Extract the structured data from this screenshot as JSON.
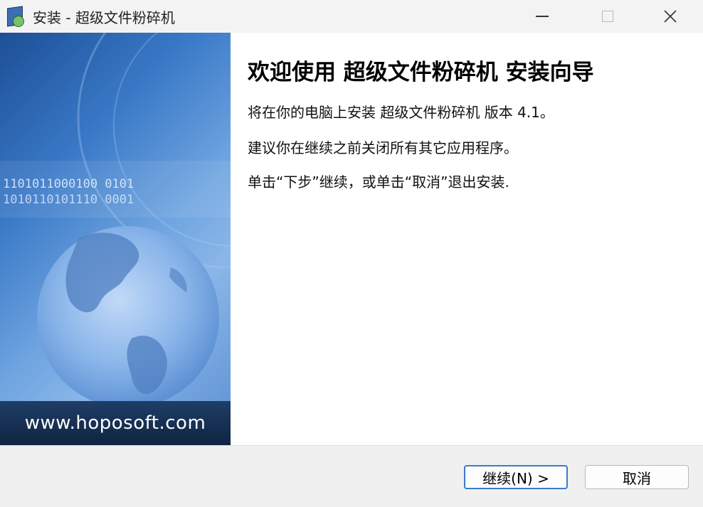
{
  "window": {
    "title": "安装 - 超级文件粉碎机"
  },
  "banner": {
    "url": "www.hoposoft.com",
    "binary_line1": "1101011000100 0101",
    "binary_line2": "1010110101110 0001"
  },
  "main": {
    "heading": "欢迎使用 超级文件粉碎机 安装向导",
    "line1": "将在你的电脑上安装 超级文件粉碎机 版本 4.1。",
    "line2": "建议你在继续之前关闭所有其它应用程序。",
    "line3": "单击“下步”继续，或单击“取消”退出安装."
  },
  "buttons": {
    "next_label": "继续(N) >",
    "cancel_label": "取消"
  },
  "colors": {
    "accent": "#3c7ad1",
    "banner_dark": "#1c4f96",
    "banner_light": "#8ab6e8"
  }
}
